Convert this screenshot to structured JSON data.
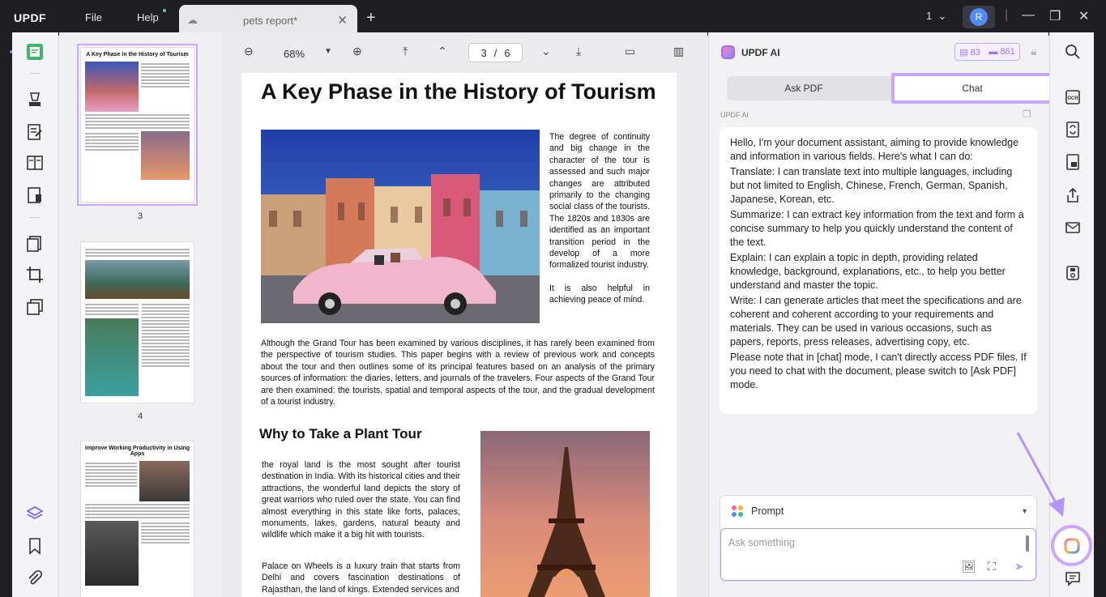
{
  "app": {
    "logo": "UPDF",
    "menu_file": "File",
    "menu_help": "Help",
    "tab_title": "pets report*",
    "window_count": "1",
    "user_initial": "R"
  },
  "doc_toolbar": {
    "zoom": "68%",
    "current_page": "3",
    "page_sep": "/",
    "total_pages": "6"
  },
  "thumbnails": [
    {
      "label": "3",
      "title": "A Key Phase in the History of Tourism",
      "selected": true
    },
    {
      "label": "4",
      "title": "",
      "selected": false
    },
    {
      "label": "",
      "title": "Improve Working Productivity in Using Apps",
      "selected": false
    }
  ],
  "document": {
    "title": "A Key Phase in the History of Tourism",
    "para_right": "The degree of continuity and big change in the character of the tour is assessed and such major changes are attributed primarily to the changing social class of the tourists. The 1820s and 1830s are identified as an important transition period in the develop of a more formalized tourist industry.",
    "para_right2": "It is also helpful in achieving peace of mind.",
    "para_main": "Although the Grand Tour has been examined by various disciplines, it has rarely been examined from the perspective of tourism studies. This paper begins with a review of previous work and concepts about the tour and then outlines some of its principal features based on an analysis of the primary sources of information: the diaries, letters, and journals of the travelers. Four aspects of the Grand Tour are then examined: the tourists, spatial and temporal aspects of the tour, and the gradual development of a tourist industry.",
    "heading2": "Why to Take a Plant Tour",
    "para_left": "the royal land is the most sought after tourist destination in India. With its historical cities and their attractions, the wonderful land depicts the story of great warriors who ruled over the state. You can find almost everything in this state like forts, palaces, monuments, lakes, gardens, natural beauty and wildlife which make it a big hit with tourists.",
    "para_left2": "Palace on Wheels is a luxury train that starts from Delhi and covers fascination destinations of Rajasthan, the land of kings. Extended services and"
  },
  "ai": {
    "title": "UPDF AI",
    "credit1": "83",
    "credit2": "861",
    "tab_ask_pdf": "Ask PDF",
    "tab_chat": "Chat",
    "sender_label": "UPDF AI",
    "message": [
      "Hello, I'm your document assistant, aiming to provide knowledge and information in various fields. Here's what I can do:",
      "Translate: I can translate text into multiple languages, including but not limited to English, Chinese, French, German, Spanish, Japanese, Korean, etc.",
      "Summarize: I can extract key information from the text and form a concise summary to help you quickly understand the content of the text.",
      "Explain: I can explain a topic in depth, providing related knowledge, background, explanations, etc., to help you better understand and master the topic.",
      "Write: I can generate articles that meet the specifications and are coherent and coherent according to your requirements and materials. They can be used in various occasions, such as papers, reports, press releases, advertising copy, etc.",
      "Please note that in [chat] mode, I can't directly access PDF files. If you need to chat with the document, please switch to [Ask PDF] mode."
    ],
    "prompt_label": "Prompt",
    "input_placeholder": "Ask something"
  },
  "colors": {
    "accent": "#9b6cff",
    "highlight": "#c9a6ff",
    "titlebar": "#1f1f23"
  }
}
